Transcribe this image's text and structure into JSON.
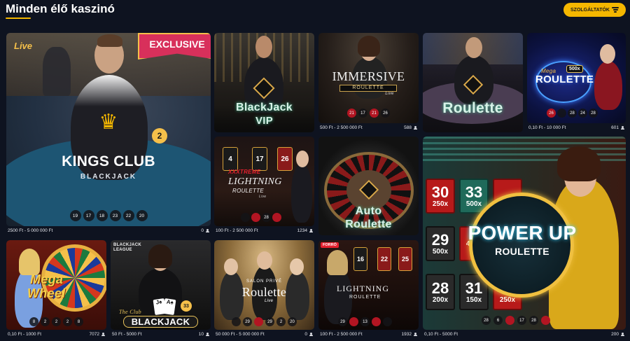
{
  "header": {
    "title": "Minden élő kaszinó",
    "providers_label": "SZOLGÁLTATÓK"
  },
  "games": [
    {
      "id": "kings-club",
      "name_line1": "KINGS CLUB",
      "name_line2": "BLACKJACK",
      "live_tag": "Live",
      "badge": "EXCLUSIVE",
      "seat_number": "2",
      "results": [
        "19",
        "17",
        "18",
        "23",
        "22",
        "20"
      ],
      "limits": "2500 Ft - 5 000 000 Ft",
      "players": "0"
    },
    {
      "id": "blackjack-vip",
      "name_line1": "BlackJack",
      "name_line2": "VIP",
      "limits": "",
      "players": ""
    },
    {
      "id": "immersive-roulette",
      "name_line1": "IMMERSIVE",
      "name_line2": "ROULETTE",
      "name_line3": "Live",
      "results": [
        "21",
        "17",
        "21",
        "26"
      ],
      "limits": "500 Ft - 2 500 000 Ft",
      "players": "588"
    },
    {
      "id": "roulette",
      "name_line1": "Roulette",
      "limits": "",
      "players": ""
    },
    {
      "id": "mega-roulette",
      "name_line1": "Mega",
      "name_line2": "ROULETTE",
      "multiplier": "500x",
      "results": [
        "26",
        "",
        "28",
        "24",
        "28"
      ],
      "limits": "0,10 Ft - 10 000 Ft",
      "players": "601"
    },
    {
      "id": "xxxtreme-lightning",
      "name_line1": "XXXTREME",
      "name_line2": "LIGHTNING",
      "name_line3": "ROULETTE",
      "name_line4": "Live",
      "tiles": [
        "4",
        "17",
        "26"
      ],
      "results": [
        "",
        "",
        "28",
        ""
      ],
      "limits": "100 Ft - 2 500 000 Ft",
      "players": "1234"
    },
    {
      "id": "auto-roulette",
      "name_line1": "Auto",
      "name_line2": "Roulette",
      "limits": "",
      "players": ""
    },
    {
      "id": "power-up-roulette",
      "name_line1": "POWER UP",
      "name_line2": "ROULETTE",
      "tiles": [
        {
          "n": "30",
          "m": "250x"
        },
        {
          "n": "33",
          "m": "500x"
        },
        {
          "n": "",
          "m": ""
        },
        {
          "n": "29",
          "m": "500x"
        },
        {
          "n": "",
          "m": "450x"
        },
        {
          "n": "28",
          "m": "200x"
        },
        {
          "n": "31",
          "m": "150x"
        },
        {
          "n": "32",
          "m": "250x"
        }
      ],
      "results": [
        "28",
        "6",
        "",
        "17",
        "28",
        ""
      ],
      "limits": "0,10 Ft - 5000 Ft",
      "players": "200"
    },
    {
      "id": "mega-wheel",
      "name_line1": "Mega",
      "name_line2": "Wheel",
      "results": [
        "8",
        "2",
        "2",
        "2",
        "8"
      ],
      "limits": "0,10 Ft - 1000 Ft",
      "players": "7072"
    },
    {
      "id": "the-club-blackjack",
      "league_line1": "BLACKJACK",
      "league_line2": "LEAGUE",
      "name_line1": "The Club",
      "name_line2": "BLACKJACK",
      "seat_number": "33",
      "limits": "50 Ft - 5000 Ft",
      "players": "10"
    },
    {
      "id": "salon-prive-roulette",
      "name_line1": "SALON PRIVÉ",
      "name_line2": "Roulette",
      "name_line3": "Live",
      "results": [
        "",
        "29",
        "",
        "29",
        "2",
        "20"
      ],
      "limits": "50 000 Ft - 5 000 000 Ft",
      "players": "0"
    },
    {
      "id": "lightning-roulette",
      "badge": "FORRÓ",
      "name_line1": "LIGHTNING",
      "name_line2": "ROULETTE",
      "tiles": [
        "16",
        "22",
        "25"
      ],
      "results": [
        "29",
        "",
        "13",
        "",
        ""
      ],
      "limits": "100 Ft - 2 500 000 Ft",
      "players": "1932"
    }
  ],
  "colors": {
    "accent": "#f5b700",
    "background": "#0e1320",
    "red": "#b21522",
    "green": "#0b8a33",
    "hot_badge": "#e5202e",
    "exclusive_badge": "#d8305b"
  }
}
